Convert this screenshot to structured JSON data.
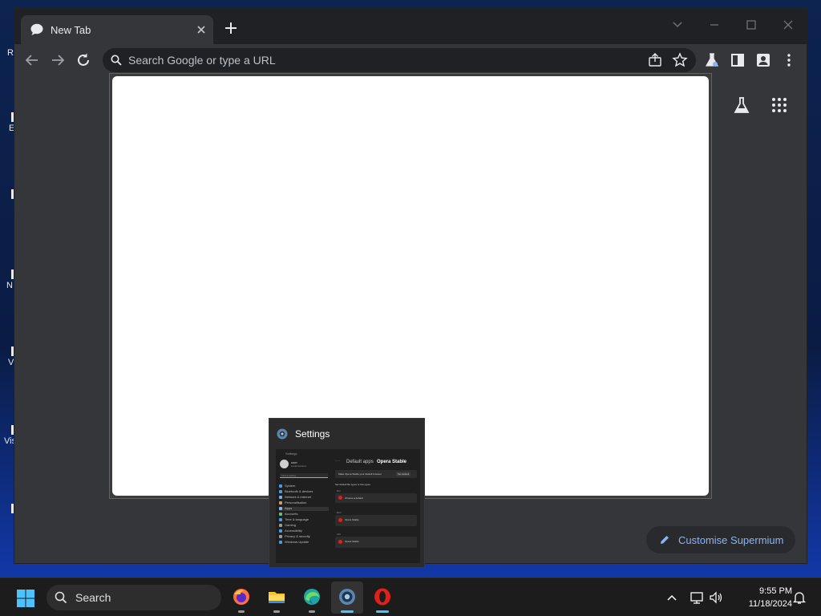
{
  "desktop": {
    "icon_labels": [
      "Re",
      "E",
      "N",
      "V",
      "Vis"
    ]
  },
  "browser": {
    "tab": {
      "title": "New Tab",
      "close_icon": "close-icon"
    },
    "new_tab_icon": "plus-icon",
    "window_controls": [
      "tab-search-icon",
      "minimize-icon",
      "maximize-icon",
      "close-icon"
    ],
    "toolbar": {
      "back_icon": "back-arrow-icon",
      "forward_icon": "forward-arrow-icon",
      "reload_icon": "reload-icon"
    },
    "omnibox": {
      "placeholder": "Search Google or type a URL",
      "value": ""
    },
    "page": {
      "customise_label": "Customise Supermium"
    }
  },
  "preview": {
    "title": "Settings",
    "thumbnail": {
      "app_label": "Settings",
      "user_name": "user",
      "user_sub": "Local Account",
      "search_placeholder": "Find a setting",
      "breadcrumb": "Default apps",
      "breadcrumb_current": "Opera Stable",
      "prompt": "Make Opera Stable your default browser",
      "set_default": "Set default",
      "section": "Set default file types or link types",
      "nav": [
        "System",
        "Bluetooth & devices",
        "Network & internet",
        "Personalisation",
        "Apps",
        "Accounts",
        "Time & language",
        "Gaming",
        "Accessibility",
        "Privacy & security",
        "Windows Update"
      ],
      "rows": [
        ".htm",
        ".html",
        ".mht"
      ],
      "row_apps": [
        "Choose a default",
        "Opera Stable",
        "Opera Stable"
      ]
    }
  },
  "taskbar": {
    "search_label": "Search",
    "apps": [
      "firefox-icon",
      "file-explorer-icon",
      "edge-icon",
      "settings-icon",
      "opera-icon"
    ],
    "time": "9:55 PM",
    "date": "11/18/2024"
  },
  "colors": {
    "accent": "#8ab4f8",
    "taskbar_active": "#4cc2ff",
    "opera_red": "#e0201b"
  }
}
